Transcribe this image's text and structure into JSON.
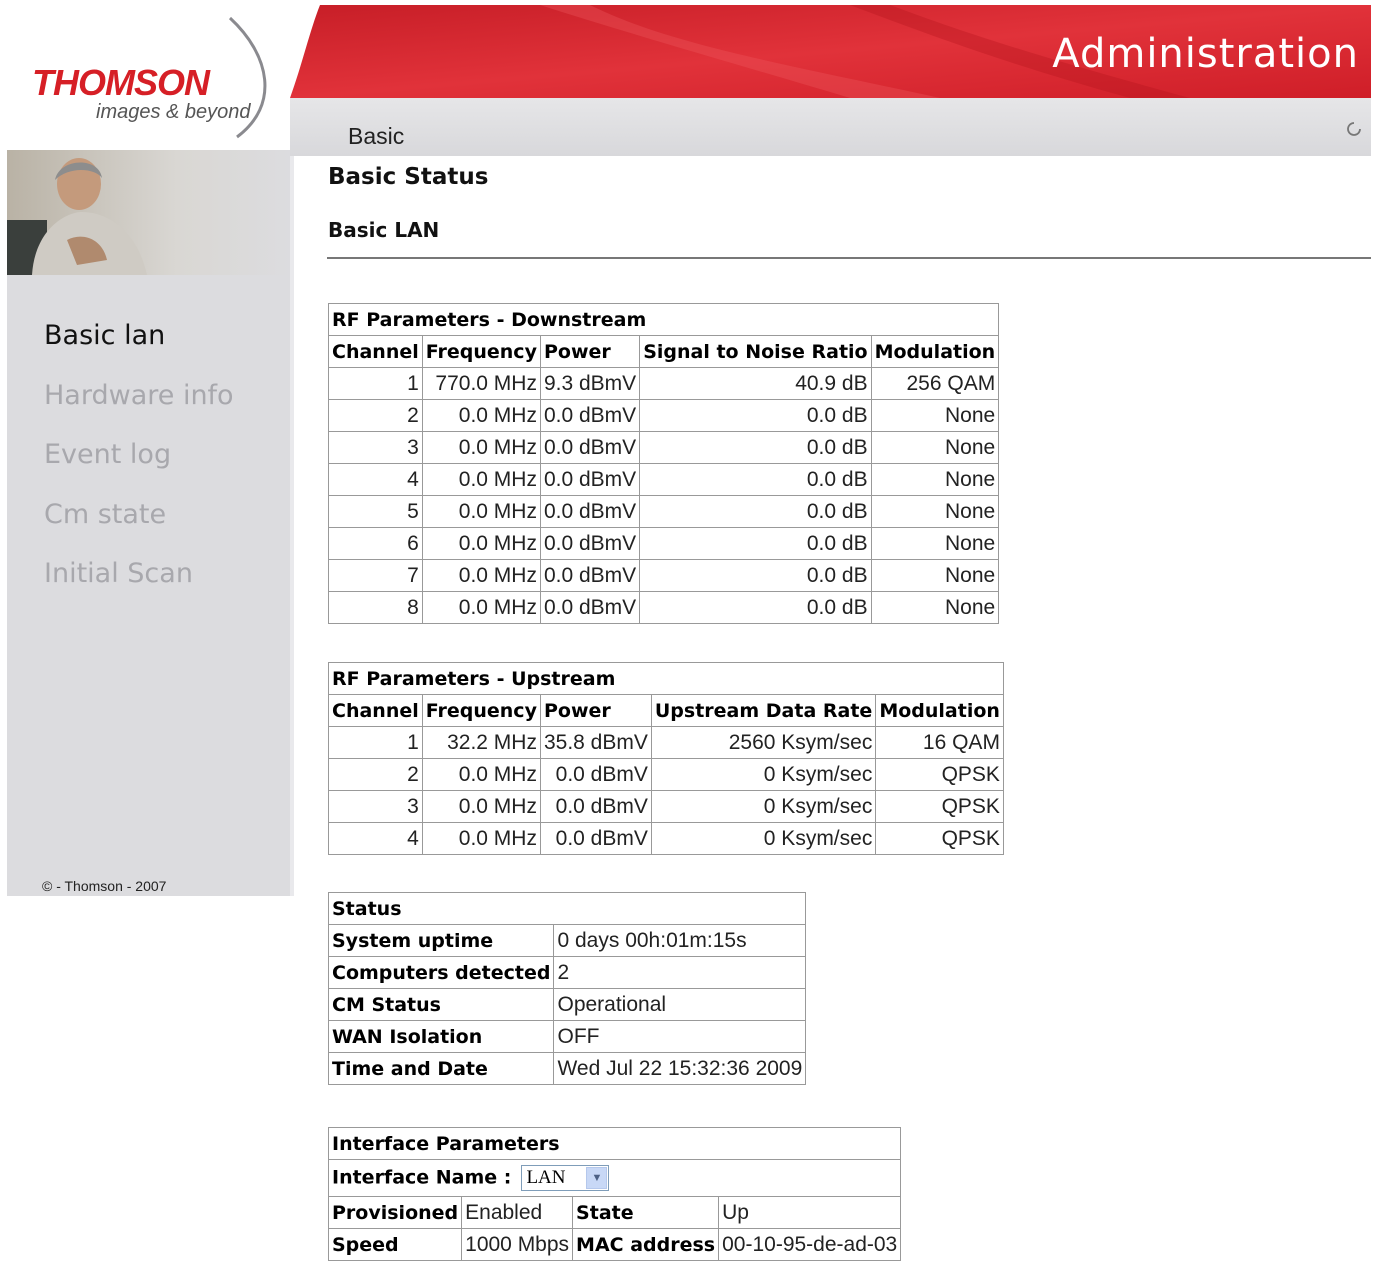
{
  "brand": {
    "name": "THOMSON",
    "tagline": "images & beyond"
  },
  "header": {
    "title": "Administration",
    "breadcrumb": "Basic"
  },
  "sidebar": {
    "items": [
      {
        "label": "Basic lan",
        "active": true
      },
      {
        "label": "Hardware info",
        "active": false
      },
      {
        "label": "Event log",
        "active": false
      },
      {
        "label": "Cm state",
        "active": false
      },
      {
        "label": "Initial Scan",
        "active": false
      }
    ],
    "copyright": "© - Thomson - 2007"
  },
  "main": {
    "title": "Basic Status",
    "subtitle": "Basic LAN"
  },
  "downstream": {
    "caption": "RF Parameters - Downstream",
    "headers": [
      "Channel",
      "Frequency",
      "Power",
      "Signal to Noise Ratio",
      "Modulation"
    ],
    "rows": [
      [
        "1",
        "770.0 MHz",
        "9.3 dBmV",
        "40.9 dB",
        "256 QAM"
      ],
      [
        "2",
        "0.0 MHz",
        "0.0 dBmV",
        "0.0 dB",
        "None"
      ],
      [
        "3",
        "0.0 MHz",
        "0.0 dBmV",
        "0.0 dB",
        "None"
      ],
      [
        "4",
        "0.0 MHz",
        "0.0 dBmV",
        "0.0 dB",
        "None"
      ],
      [
        "5",
        "0.0 MHz",
        "0.0 dBmV",
        "0.0 dB",
        "None"
      ],
      [
        "6",
        "0.0 MHz",
        "0.0 dBmV",
        "0.0 dB",
        "None"
      ],
      [
        "7",
        "0.0 MHz",
        "0.0 dBmV",
        "0.0 dB",
        "None"
      ],
      [
        "8",
        "0.0 MHz",
        "0.0 dBmV",
        "0.0 dB",
        "None"
      ]
    ]
  },
  "upstream": {
    "caption": "RF Parameters - Upstream",
    "headers": [
      "Channel",
      "Frequency",
      "Power",
      "Upstream Data Rate",
      "Modulation"
    ],
    "rows": [
      [
        "1",
        "32.2 MHz",
        "35.8 dBmV",
        "2560 Ksym/sec",
        "16 QAM"
      ],
      [
        "2",
        "0.0 MHz",
        "0.0 dBmV",
        "0 Ksym/sec",
        "QPSK"
      ],
      [
        "3",
        "0.0 MHz",
        "0.0 dBmV",
        "0 Ksym/sec",
        "QPSK"
      ],
      [
        "4",
        "0.0 MHz",
        "0.0 dBmV",
        "0 Ksym/sec",
        "QPSK"
      ]
    ]
  },
  "status": {
    "caption": "Status",
    "rows": [
      [
        "System uptime",
        "0 days 00h:01m:15s"
      ],
      [
        "Computers detected",
        "2"
      ],
      [
        "CM Status",
        "Operational"
      ],
      [
        "WAN Isolation",
        "OFF"
      ],
      [
        "Time and Date",
        "Wed Jul 22 15:32:36 2009"
      ]
    ]
  },
  "interface": {
    "caption": "Interface Parameters",
    "name_label": "Interface Name :",
    "selected": "LAN",
    "rows": [
      [
        "Provisioned",
        "Enabled",
        "State",
        "Up"
      ],
      [
        "Speed",
        "1000 Mbps",
        "MAC address",
        "00-10-95-de-ad-03"
      ]
    ]
  },
  "colors": {
    "banner_red": "#d61f26",
    "sidebar_gray": "#dcdcdf",
    "inactive_menu": "#a8a8ad"
  }
}
